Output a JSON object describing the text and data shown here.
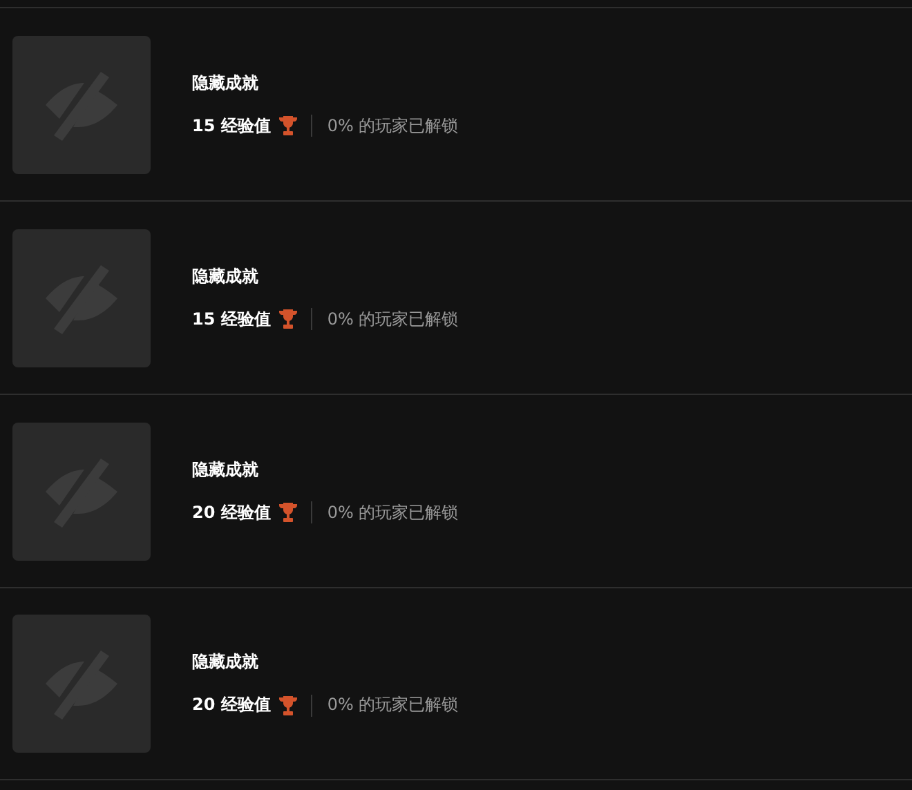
{
  "achievements": [
    {
      "title": "隐藏成就",
      "xp": "15 经验值",
      "unlocked": "0% 的玩家已解锁"
    },
    {
      "title": "隐藏成就",
      "xp": "15 经验值",
      "unlocked": "0% 的玩家已解锁"
    },
    {
      "title": "隐藏成就",
      "xp": "20 经验值",
      "unlocked": "0% 的玩家已解锁"
    },
    {
      "title": "隐藏成就",
      "xp": "20 经验值",
      "unlocked": "0% 的玩家已解锁"
    }
  ]
}
